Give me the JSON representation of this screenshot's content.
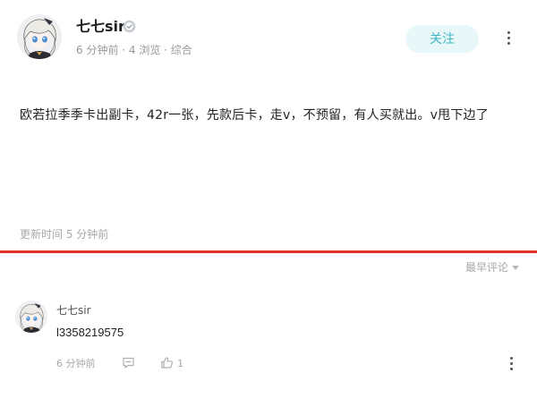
{
  "post": {
    "author": "七七sir",
    "meta": "6 分钟前 · 4 浏览 · 综合",
    "follow_label": "关注",
    "content": "欧若拉季季卡出副卡，42r一张，先款后卡，走v，不预留，有人买就出。v甩下边了",
    "update_time": "更新时间 5 分钟前"
  },
  "comments_section": {
    "sort_label": "最早评论"
  },
  "comments": [
    {
      "author": "七七sir",
      "text": "l3358219575",
      "time": "6 分钟前",
      "like_count": "1"
    }
  ],
  "colors": {
    "accent": "#3fb7c4",
    "follow_bg": "#e8f7f8",
    "divider": "#e0322b",
    "muted_text": "#a8a8a8"
  },
  "icons": {
    "verified": "verified-badge-icon",
    "more": "more-vertical-icon",
    "reply": "comment-icon",
    "like": "thumbs-up-icon",
    "sort_caret": "caret-down-icon"
  }
}
